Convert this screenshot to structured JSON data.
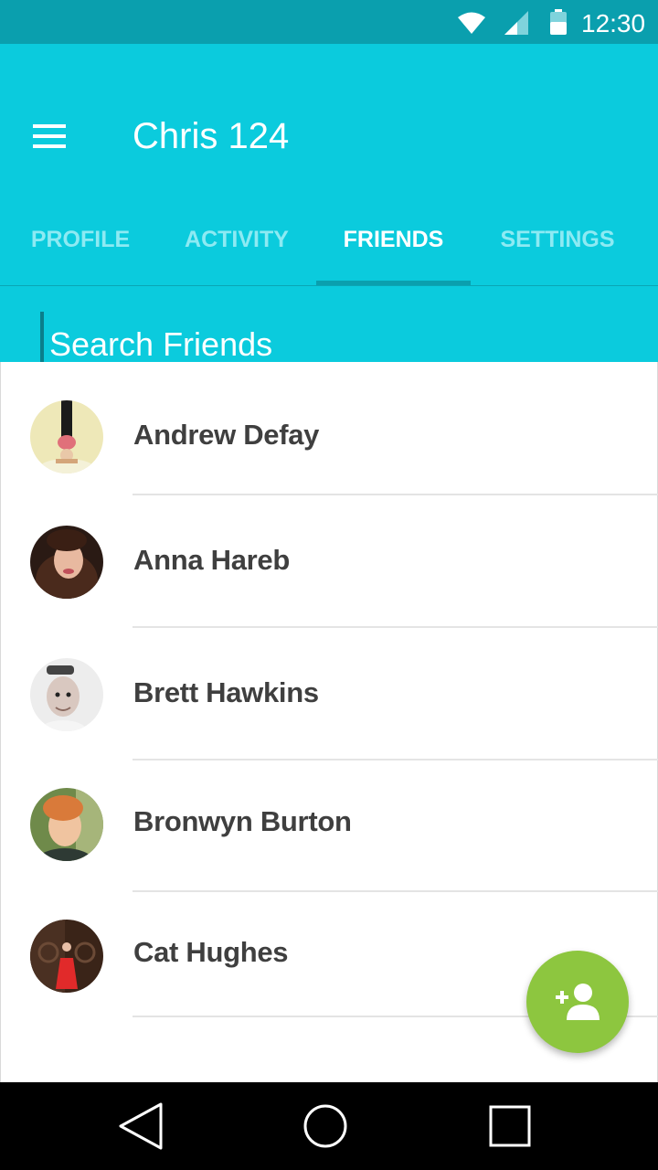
{
  "status_bar": {
    "time": "12:30",
    "icons": [
      "wifi-icon",
      "cell-signal-icon",
      "battery-icon"
    ]
  },
  "app_bar": {
    "menu_icon": "hamburger-menu-icon",
    "title": "Chris 124"
  },
  "tabs": [
    {
      "label": "PROFILE",
      "active": false
    },
    {
      "label": "ACTIVITY",
      "active": false
    },
    {
      "label": "FRIENDS",
      "active": true
    },
    {
      "label": "SETTINGS",
      "active": false
    }
  ],
  "search": {
    "placeholder": "Search Friends",
    "value": ""
  },
  "friends": [
    {
      "name": "Andrew Defay",
      "avatar": "avatar-photo"
    },
    {
      "name": "Anna Hareb",
      "avatar": "avatar-photo"
    },
    {
      "name": "Brett Hawkins",
      "avatar": "avatar-photo"
    },
    {
      "name": "Bronwyn Burton",
      "avatar": "avatar-photo"
    },
    {
      "name": "Cat Hughes",
      "avatar": "avatar-photo"
    }
  ],
  "fab": {
    "icon": "add-person-icon"
  },
  "nav_bar": {
    "icons": [
      "back-icon",
      "home-icon",
      "recents-icon"
    ]
  },
  "colors": {
    "status_bar": "#0a9fae",
    "app_bar": "#0bcbdd",
    "tab_inactive": "#8deaf3",
    "tab_indicator": "#0a9fae",
    "fab": "#8dc63f",
    "name_text": "#3f3f3f"
  }
}
